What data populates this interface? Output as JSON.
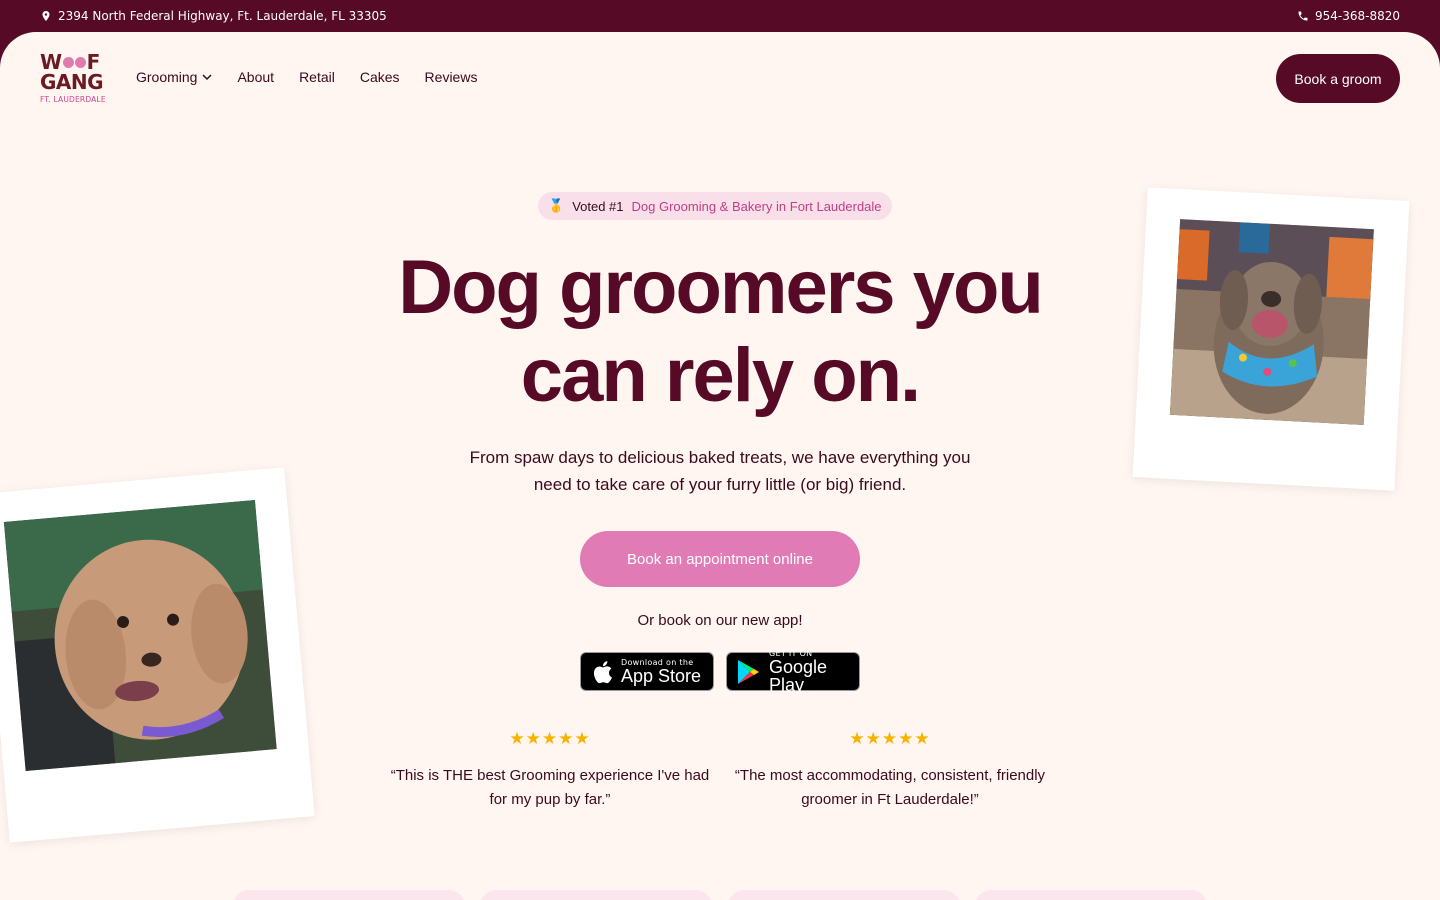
{
  "topbar": {
    "address": "2394 North Federal Highway, Ft. Lauderdale, FL 33305",
    "phone": "954-368-8820"
  },
  "logo": {
    "line1": "W",
    "line1_end": "F",
    "line2": "GANG",
    "line3": "FT. LAUDERDALE"
  },
  "nav": {
    "items": [
      "Grooming",
      "About",
      "Retail",
      "Cakes",
      "Reviews"
    ]
  },
  "header": {
    "cta": "Book a groom"
  },
  "hero": {
    "badge_medal": "🥇",
    "badge_prefix": "Voted #1",
    "badge_text": "Dog Grooming & Bakery in Fort Lauderdale",
    "title_line1": "Dog groomers you",
    "title_line2": "can rely on.",
    "subtitle": "From spaw days to delicious baked treats, we have everything you need to take care of your furry little (or big) friend.",
    "book_button": "Book an appointment online",
    "or_text": "Or book on our new app!"
  },
  "apps": {
    "appstore_small": "Download on the",
    "appstore_big": "App Store",
    "gplay_small": "GET IT ON",
    "gplay_big": "Google Play"
  },
  "reviews": [
    {
      "stars": "★★★★★",
      "rating": 5,
      "quote": "“This is THE best Grooming experience I've had for my pup by far.”"
    },
    {
      "stars": "★★★★★",
      "rating": 5,
      "quote": "“The most accommodating, consistent, friendly groomer in Ft Lauderdale!”"
    }
  ],
  "colors": {
    "brand_dark": "#560a26",
    "brand_pink": "#e07bb5",
    "background": "#fff5f1",
    "star": "#f5b400"
  }
}
